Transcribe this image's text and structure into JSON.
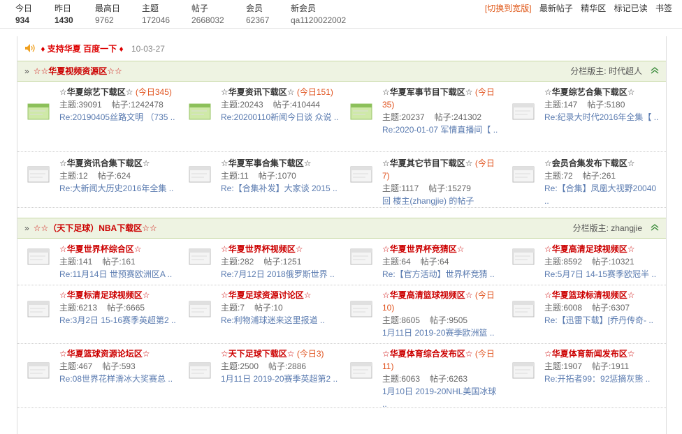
{
  "stats": [
    {
      "label": "今日",
      "value": "934",
      "bold": true
    },
    {
      "label": "昨日",
      "value": "1430",
      "bold": true
    },
    {
      "label": "最高日",
      "value": "9762",
      "bold": false
    },
    {
      "label": "主题",
      "value": "172046",
      "bold": false
    },
    {
      "label": "帖子",
      "value": "2668032",
      "bold": false
    },
    {
      "label": "会员",
      "value": "62367",
      "bold": false
    },
    {
      "label": "新会员",
      "value": "qa1120022002",
      "bold": false
    }
  ],
  "toplinks": {
    "wide": "[切换到宽版]",
    "latest": "最新帖子",
    "digest": "精华区",
    "mark_read": "标记已读",
    "bookmark": "书签"
  },
  "notice": {
    "text": "♦ 支持华夏  百度一下 ♦",
    "date": "10-03-27"
  },
  "categories": [
    {
      "title": "☆☆华夏视频资源区☆☆",
      "moderator_label": "分栏版主:",
      "moderator": "时代超人",
      "rows": [
        [
          {
            "name": "☆华夏综艺下载区☆",
            "today": "(今日345)",
            "topics": "主题:39091",
            "posts": "帖子:1242478",
            "last": "Re:20190405丝路文明 （735 ..",
            "new": true,
            "red": false
          },
          {
            "name": "☆华夏资讯下载区☆",
            "today": "(今日151)",
            "topics": "主题:20243",
            "posts": "帖子:410444",
            "last": "Re:20200110新闻今日谈 众说 ..",
            "new": true,
            "red": false
          },
          {
            "name": "☆华夏军事节目下载区☆",
            "today": "(今日35)",
            "topics": "主题:20237",
            "posts": "帖子:241302",
            "last": "Re:2020-01-07 军情直播间【 ..",
            "new": true,
            "red": false
          },
          {
            "name": "☆华夏综艺合集下载区☆",
            "today": "",
            "topics": "主题:147",
            "posts": "帖子:5180",
            "last": "Re:纪录大时代2016年全集【 ..",
            "new": false,
            "red": false
          }
        ],
        [
          {
            "name": "☆华夏资讯合集下载区☆",
            "today": "",
            "topics": "主题:12",
            "posts": "帖子:624",
            "last": "Re:大新闻大历史2016年全集 ..",
            "new": false,
            "red": false
          },
          {
            "name": "☆华夏军事合集下载区☆",
            "today": "",
            "topics": "主题:11",
            "posts": "帖子:1070",
            "last": "Re:【合集补发】大家谈 2015 ..",
            "new": false,
            "red": false
          },
          {
            "name": "☆华夏其它节目下载区☆",
            "today": "(今日7)",
            "topics": "主题:1117",
            "posts": "帖子:15279",
            "last": "回 楼主(zhangjie) 的帖子",
            "new": false,
            "red": false
          },
          {
            "name": "☆会员合集发布下载区☆",
            "today": "",
            "topics": "主题:72",
            "posts": "帖子:261",
            "last": "Re:【合集】凤凰大视野20040 ..",
            "new": false,
            "red": false
          }
        ]
      ]
    },
    {
      "title": "☆☆（天下足球）NBA下载区☆☆",
      "moderator_label": "分栏版主:",
      "moderator": "zhangjie",
      "rows": [
        [
          {
            "name": "☆华夏世界杯综合区☆",
            "today": "",
            "topics": "主题:141",
            "posts": "帖子:161",
            "last": "Re:11月14日 世预赛欧洲区A ..",
            "new": false,
            "red": true
          },
          {
            "name": "☆华夏世界杯视频区☆",
            "today": "",
            "topics": "主题:282",
            "posts": "帖子:1251",
            "last": "Re:7月12日 2018俄罗斯世界 ..",
            "new": false,
            "red": true
          },
          {
            "name": "☆华夏世界杯竞猜区☆",
            "today": "",
            "topics": "主题:64",
            "posts": "帖子:64",
            "last": "Re:【官方活动】世界杯竞猜 ..",
            "new": false,
            "red": true
          },
          {
            "name": "☆华夏高清足球视频区☆",
            "today": "",
            "topics": "主题:8592",
            "posts": "帖子:10321",
            "last": "Re:5月7日 14-15赛季欧冠半 ..",
            "new": false,
            "red": true
          }
        ],
        [
          {
            "name": "☆华夏标清足球视频区☆",
            "today": "",
            "topics": "主题:6213",
            "posts": "帖子:6665",
            "last": "Re:3月2日 15-16赛季英超第2 ..",
            "new": false,
            "red": true
          },
          {
            "name": "☆华夏足球资源讨论区☆",
            "today": "",
            "topics": "主题:7",
            "posts": "帖子:10",
            "last": "Re:利物浦球迷来这里报道 ..",
            "new": false,
            "red": true
          },
          {
            "name": "☆华夏高清篮球视频区☆",
            "today": "(今日10)",
            "topics": "主题:8605",
            "posts": "帖子:9505",
            "last": "1月11日 2019-20赛季欧洲篮 ..",
            "new": false,
            "red": true
          },
          {
            "name": "☆华夏篮球标清视频区☆",
            "today": "",
            "topics": "主题:6008",
            "posts": "帖子:6307",
            "last": "Re:【迅雷下载】[乔丹传奇- ..",
            "new": false,
            "red": true
          }
        ],
        [
          {
            "name": "☆华夏篮球资源论坛区☆",
            "today": "",
            "topics": "主题:467",
            "posts": "帖子:593",
            "last": "Re:08世界花样滑冰大奖赛总 ..",
            "new": false,
            "red": true
          },
          {
            "name": "☆天下足球下载区☆",
            "today": "(今日3)",
            "topics": "主题:2500",
            "posts": "帖子:2886",
            "last": "1月11日 2019-20赛季英超第2 ..",
            "new": false,
            "red": true
          },
          {
            "name": "☆华夏体育综合发布区☆",
            "today": "(今日11)",
            "topics": "主题:6063",
            "posts": "帖子:6263",
            "last": "1月10日 2019-20NHL美国冰球 ..",
            "new": false,
            "red": true
          },
          {
            "name": "☆华夏体育新闻发布区☆",
            "today": "",
            "topics": "主题:1907",
            "posts": "帖子:1911",
            "last": "Re:开拓者99：92惩摘灰熊 ..",
            "new": false,
            "red": true
          }
        ]
      ]
    }
  ]
}
